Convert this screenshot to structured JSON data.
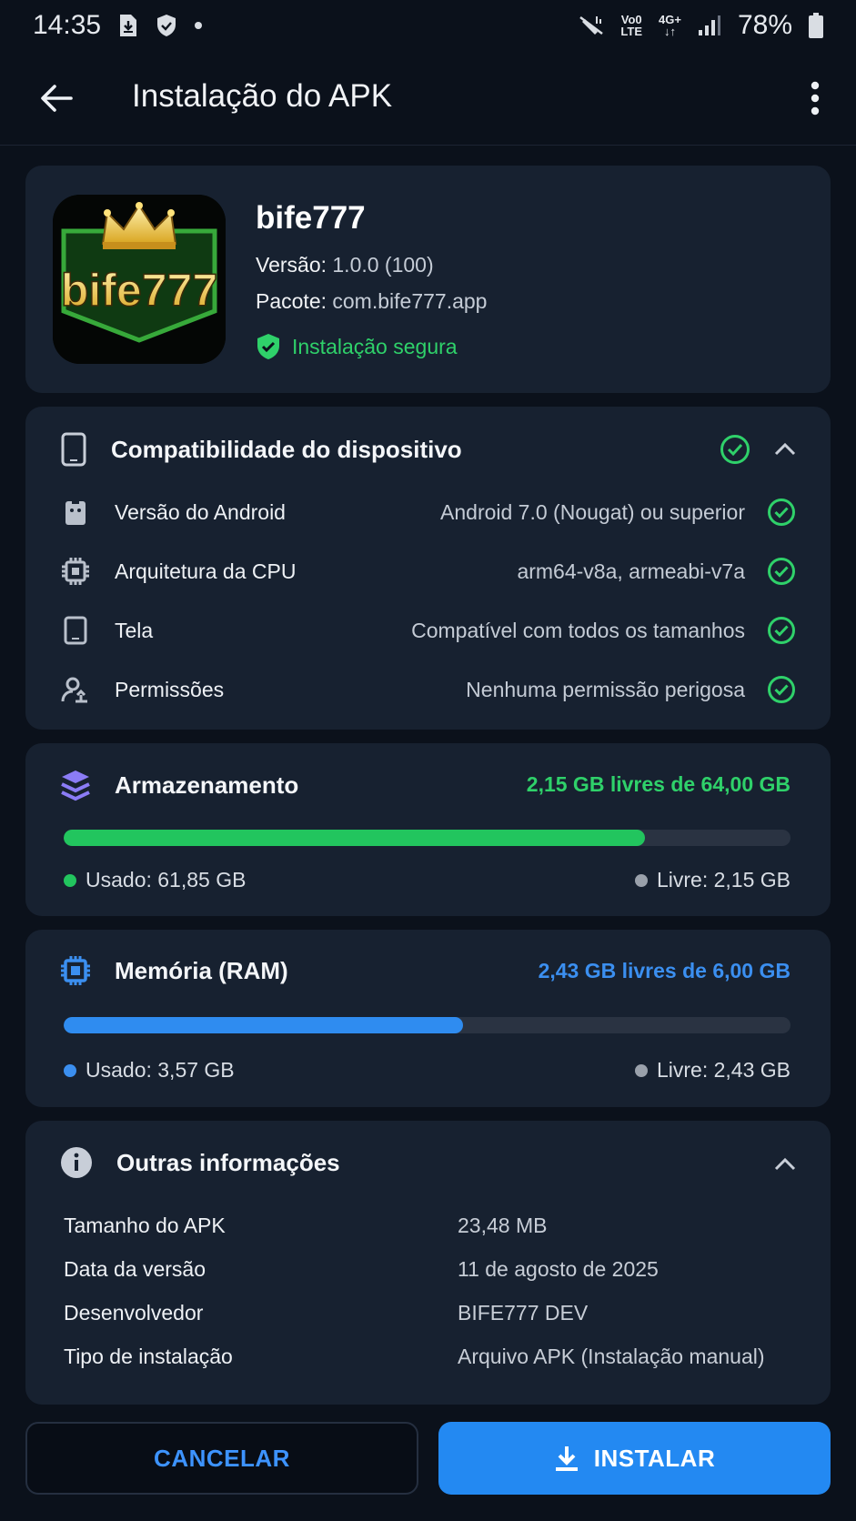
{
  "status_bar": {
    "time": "14:35",
    "network_top": "Vo0",
    "network_bottom": "LTE",
    "network_gen": "4G+",
    "battery": "78%"
  },
  "app_bar": {
    "title": "Instalação do APK"
  },
  "app": {
    "name": "bife777",
    "logo_text": "bife777",
    "version_label": "Versão:",
    "version_value": "1.0.0 (100)",
    "package_label": "Pacote:",
    "package_value": "com.bife777.app",
    "secure_label": "Instalação segura"
  },
  "compatibility": {
    "title": "Compatibilidade do dispositivo",
    "rows": [
      {
        "label": "Versão do Android",
        "value": "Android 7.0 (Nougat) ou superior",
        "icon": "android-icon"
      },
      {
        "label": "Arquitetura da CPU",
        "value": "arm64-v8a, armeabi-v7a",
        "icon": "cpu-icon"
      },
      {
        "label": "Tela",
        "value": "Compatível com todos os tamanhos",
        "icon": "tablet-icon"
      },
      {
        "label": "Permissões",
        "value": "Nenhuma permissão perigosa",
        "icon": "permission-icon"
      }
    ]
  },
  "storage": {
    "title": "Armazenamento",
    "summary": "2,15 GB livres de 64,00 GB",
    "used_label": "Usado: 61,85 GB",
    "free_label": "Livre: 2,15 GB",
    "used_fraction": 0.8,
    "color": "#22c55e"
  },
  "memory": {
    "title": "Memória (RAM)",
    "summary": "2,43 GB livres de 6,00 GB",
    "used_label": "Usado: 3,57 GB",
    "free_label": "Livre: 2,43 GB",
    "used_fraction": 0.55,
    "color": "#2f8cf0"
  },
  "other_info": {
    "title": "Outras informações",
    "rows": [
      {
        "label": "Tamanho do APK",
        "value": "23,48 MB"
      },
      {
        "label": "Data da versão",
        "value": "11 de agosto de 2025"
      },
      {
        "label": "Desenvolvedor",
        "value": "BIFE777 DEV"
      },
      {
        "label": "Tipo de instalação",
        "value": "Arquivo APK (Instalação manual)"
      }
    ]
  },
  "actions": {
    "cancel": "CANCELAR",
    "install": "INSTALAR"
  }
}
